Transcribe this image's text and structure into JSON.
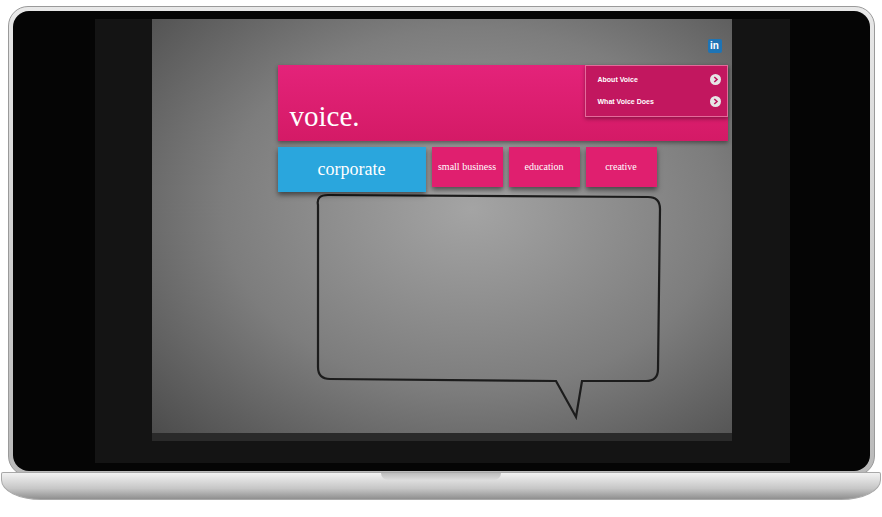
{
  "site": {
    "logo": "voice.",
    "social": "in",
    "menu": [
      {
        "label": "About Voice"
      },
      {
        "label": "What Voice Does"
      }
    ],
    "tabs": [
      {
        "label": "corporate",
        "selected": true
      },
      {
        "label": "small business",
        "selected": false
      },
      {
        "label": "education",
        "selected": false
      },
      {
        "label": "creative",
        "selected": false
      }
    ]
  }
}
